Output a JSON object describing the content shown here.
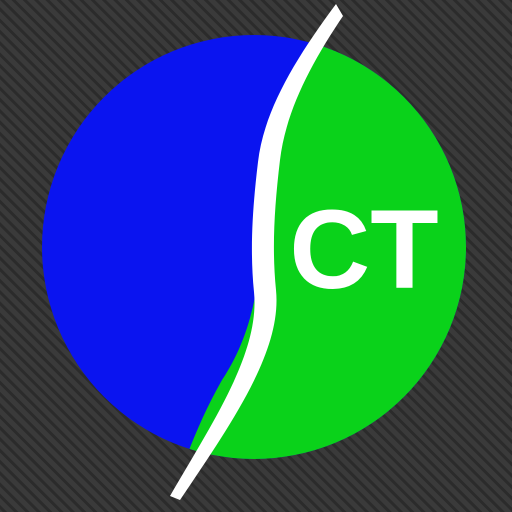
{
  "icon": {
    "name": "ct-app-icon",
    "logo_text": "CT",
    "colors": {
      "background": "#3a3a3a",
      "background_stripe": "#2b2b2b",
      "left_half": "#0a14f0",
      "right_half": "#0ad21a",
      "divider": "#ffffff",
      "text": "#ffffff"
    }
  }
}
